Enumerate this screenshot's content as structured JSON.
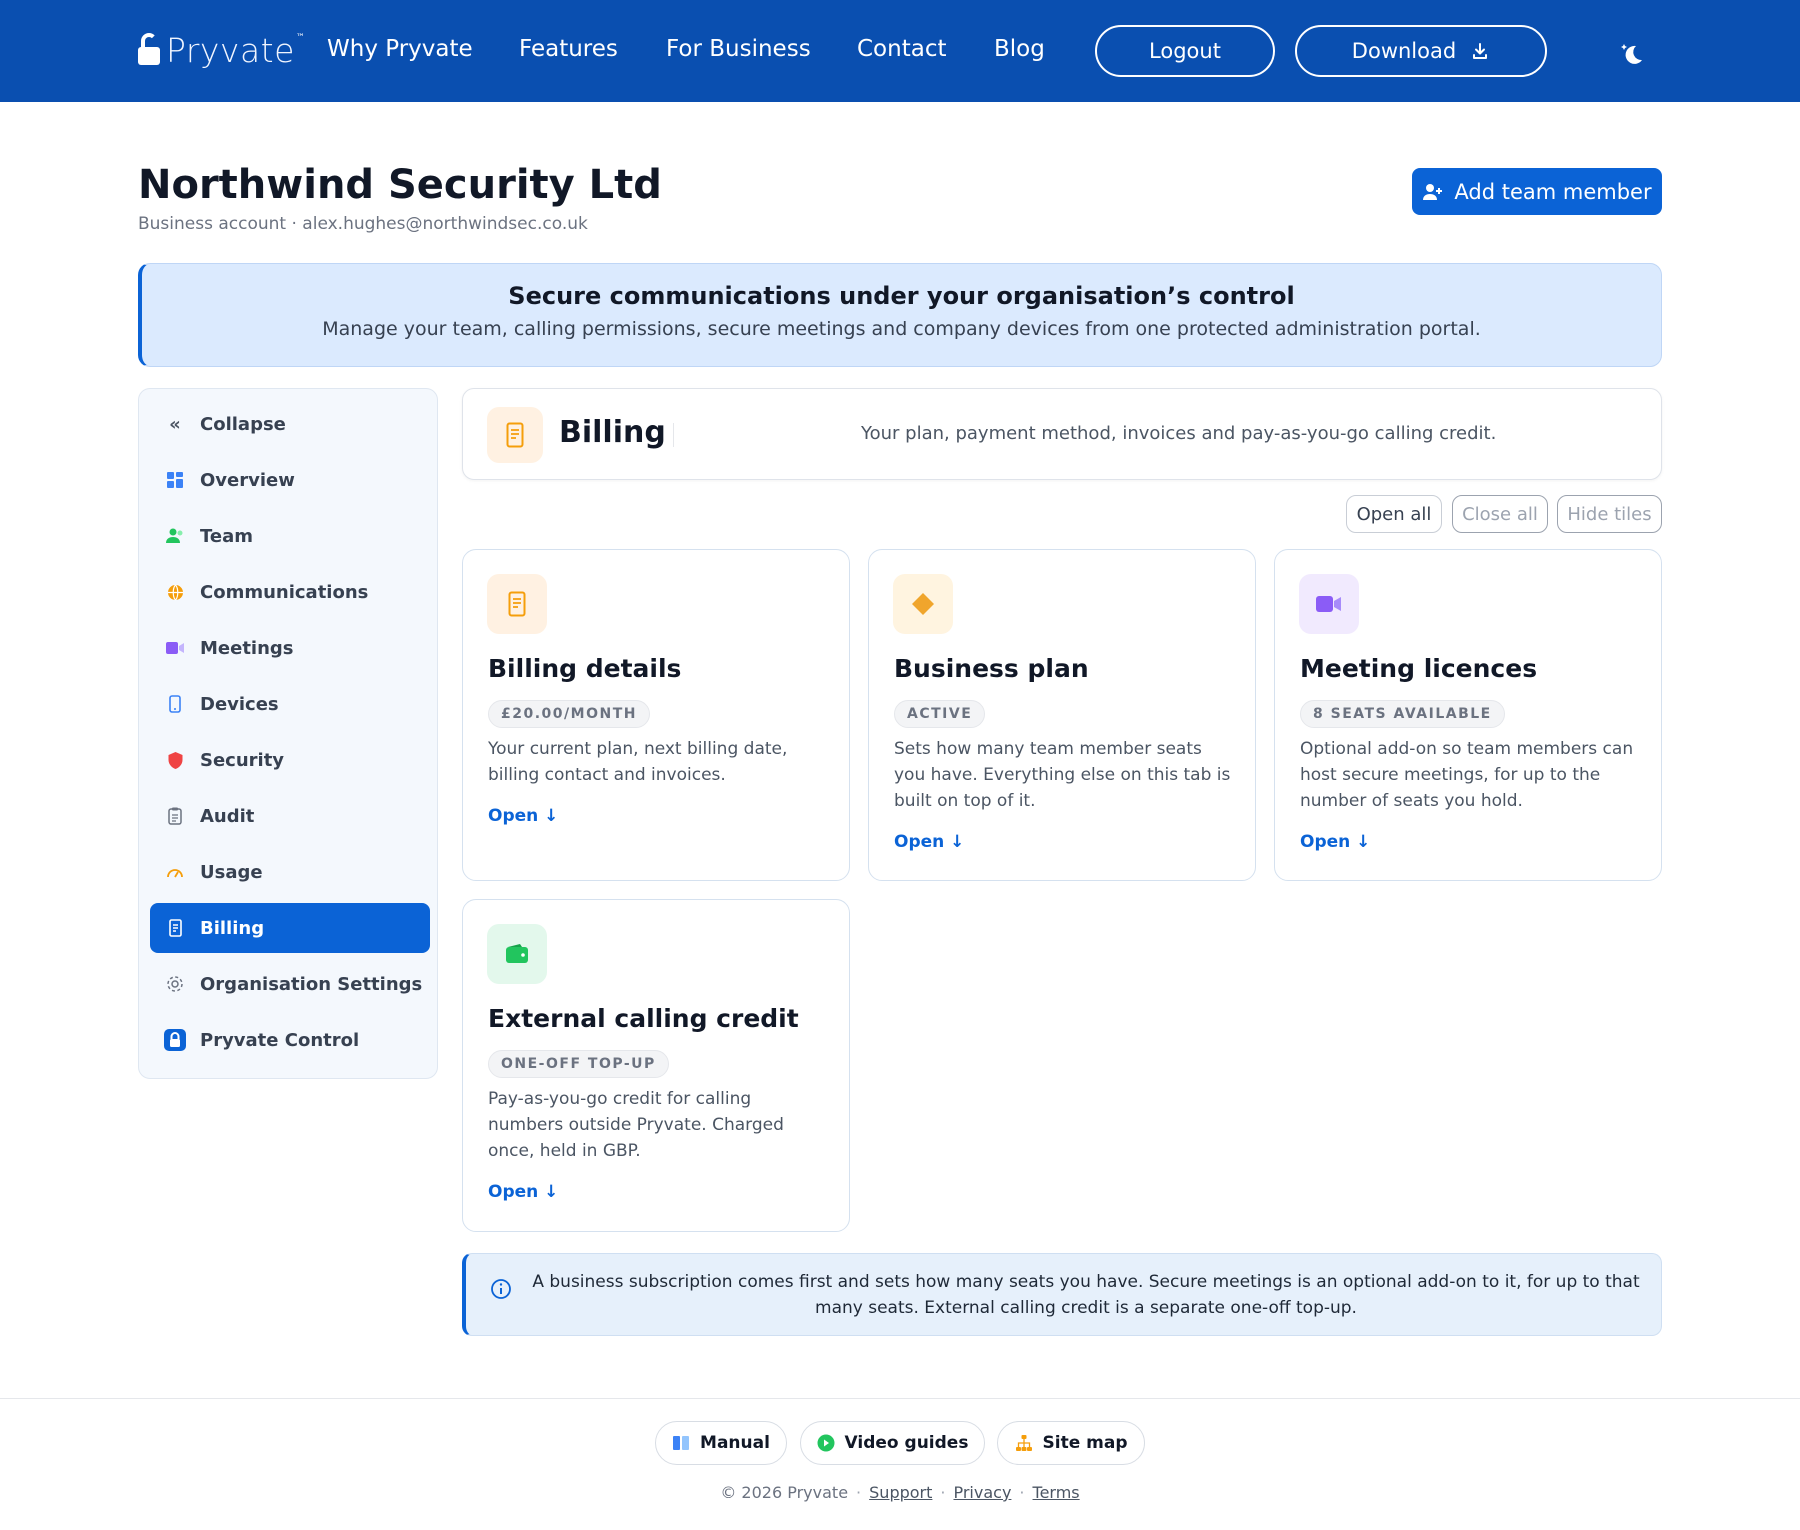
{
  "header": {
    "logo_text": "Pryvate",
    "logo_tm": "™",
    "nav": [
      "Why Pryvate",
      "Features",
      "For Business",
      "Contact",
      "Blog"
    ],
    "logout_label": "Logout",
    "download_label": "Download",
    "download_icon": "download-icon",
    "theme_icon": "moon-stars-icon",
    "bg_color": "#0a4fb0"
  },
  "org": {
    "name": "Northwind Security Ltd",
    "subtitle": "Business account · alex.hughes@northwindsec.co.uk",
    "add_member_label": "Add team member"
  },
  "banner": {
    "title": "Secure communications under your organisation’s control",
    "text": "Manage your team, calling permissions, secure meetings and company devices from one protected administration portal."
  },
  "sidebar": {
    "collapse_label": "Collapse",
    "items": [
      {
        "label": "Overview",
        "icon": "grid-icon",
        "color": "#3b82f6"
      },
      {
        "label": "Team",
        "icon": "users-icon",
        "color": "#22c55e"
      },
      {
        "label": "Communications",
        "icon": "globe-icon",
        "color": "#f59e0b"
      },
      {
        "label": "Meetings",
        "icon": "video-icon",
        "color": "#8b5cf6"
      },
      {
        "label": "Devices",
        "icon": "phone-icon",
        "color": "#3b82f6"
      },
      {
        "label": "Security",
        "icon": "shield-icon",
        "color": "#ef4444"
      },
      {
        "label": "Audit",
        "icon": "clipboard-icon",
        "color": "#6b7280"
      },
      {
        "label": "Usage",
        "icon": "gauge-icon",
        "color": "#f59e0b"
      },
      {
        "label": "Billing",
        "icon": "receipt-icon",
        "color": "#ffffff",
        "active": true
      },
      {
        "label": "Organisation Settings",
        "icon": "gear-icon",
        "color": "#6b7280"
      },
      {
        "label": "Pryvate Control",
        "icon": "lock-icon",
        "color": "#0b63d6"
      }
    ]
  },
  "section": {
    "title": "Billing",
    "description": "Your plan, payment method, invoices and pay-as-you-go calling credit.",
    "open_all": "Open all",
    "close_all": "Close all",
    "hide_tiles": "Hide tiles"
  },
  "tiles": [
    {
      "title": "Billing details",
      "badge": "£20.00/MONTH",
      "description": "Your current plan, next billing date, billing contact and invoices.",
      "open": "Open ↓",
      "icon": "receipt-icon",
      "icon_color": "#f59e0b",
      "icon_bg": "#fff1e2"
    },
    {
      "title": "Business plan",
      "badge": "ACTIVE",
      "description": "Sets how many team member seats you have. Everything else on this tab is built on top of it.",
      "open": "Open ↓",
      "icon": "diamond-icon",
      "icon_color": "#f0a52c",
      "icon_bg": "#fff4e0"
    },
    {
      "title": "Meeting licences",
      "badge": "8 SEATS AVAILABLE",
      "description": "Optional add-on so team members can host secure meetings, for up to the number of seats you hold.",
      "open": "Open ↓",
      "icon": "video-icon",
      "icon_color": "#8b5cf6",
      "icon_bg": "#f1eafe"
    },
    {
      "title": "External calling credit",
      "badge": "ONE-OFF TOP-UP",
      "description": "Pay-as-you-go credit for calling numbers outside Pryvate. Charged once, held in GBP.",
      "open": "Open ↓",
      "icon": "wallet-icon",
      "icon_color": "#22c55e",
      "icon_bg": "#e3f8ec"
    }
  ],
  "note": {
    "text": "A business subscription comes first and sets how many seats you have. Secure meetings is an optional add-on to it, for up to that many seats. External calling credit is a separate one-off top-up.",
    "icon": "info-icon"
  },
  "footer": {
    "chips": [
      {
        "label": "Manual",
        "icon": "book-icon"
      },
      {
        "label": "Video guides",
        "icon": "play-icon"
      },
      {
        "label": "Site map",
        "icon": "sitemap-icon"
      }
    ],
    "copyright": "© 2026 Pryvate",
    "links": [
      "Support",
      "Privacy",
      "Terms"
    ]
  }
}
